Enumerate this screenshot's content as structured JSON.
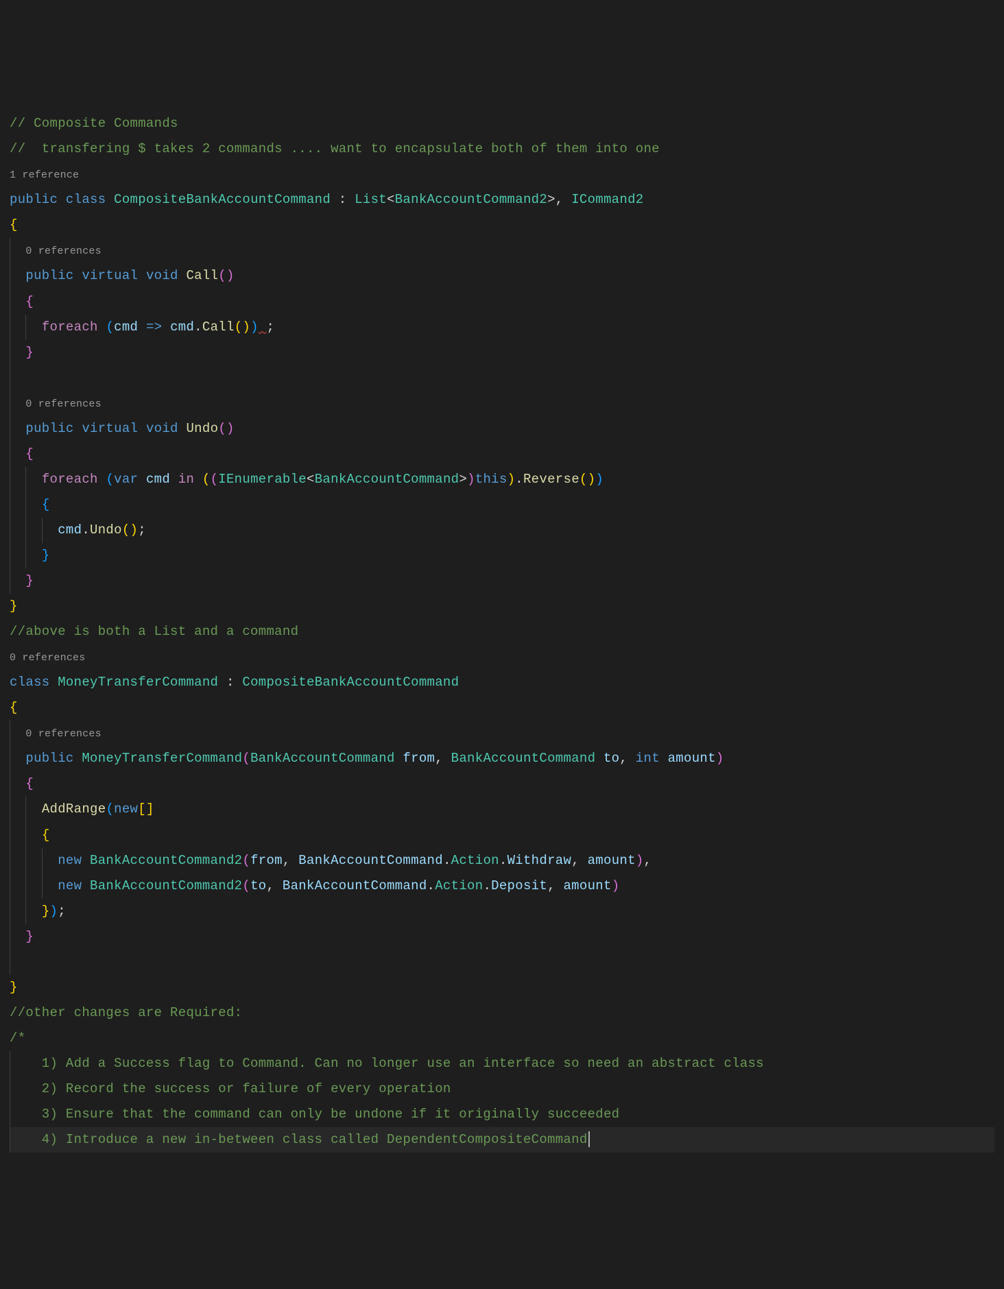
{
  "lines": {
    "l1_c": "// Composite Commands",
    "l2_c": "//  transfering $ takes 2 commands .... want to encapsulate both of them into one",
    "l3_ref": "1 reference",
    "l4": {
      "kw1": "public",
      "kw2": "class",
      "type1": "CompositeBankAccountCommand",
      "colon": ":",
      "type2": "List",
      "lt": "<",
      "type3": "BankAccountCommand2",
      "gt": ">",
      "comma": ",",
      "type4": "ICommand2"
    },
    "l5_b": "{",
    "l6_ref": "0 references",
    "l7": {
      "kw1": "public",
      "kw2": "virtual",
      "kw3": "void",
      "m": "Call"
    },
    "l8_b": "{",
    "l9": {
      "fe": "foreach",
      "v": "cmd",
      "arrow": "=>",
      "v2": "cmd",
      "m": "Call"
    },
    "l10_b": "}",
    "l11_ref": "0 references",
    "l12": {
      "kw1": "public",
      "kw2": "virtual",
      "kw3": "void",
      "m": "Undo"
    },
    "l13_b": "{",
    "l14": {
      "fe": "foreach",
      "var": "var",
      "v": "cmd",
      "in": "in",
      "t1": "IEnumerable",
      "t2": "BankAccountCommand",
      "th": "this",
      "m": "Reverse"
    },
    "l15_b": "{",
    "l16": {
      "v": "cmd",
      "m": "Undo"
    },
    "l17_b": "}",
    "l18_b": "}",
    "l19_b": "}",
    "l20_c": "//above is both a List and a command",
    "l21_ref": "0 references",
    "l22": {
      "kw": "class",
      "t1": "MoneyTransferCommand",
      "colon": ":",
      "t2": "CompositeBankAccountCommand"
    },
    "l23_b": "{",
    "l24_ref": "0 references",
    "l25": {
      "kw": "public",
      "t1": "MoneyTransferCommand",
      "t2": "BankAccountCommand",
      "p1": "from",
      "t3": "BankAccountCommand",
      "p2": "to",
      "t4": "int",
      "p3": "amount"
    },
    "l26_b": "{",
    "l27": {
      "m": "AddRange",
      "kw": "new"
    },
    "l28_b": "{",
    "l29": {
      "kw": "new",
      "t1": "BankAccountCommand2",
      "v1": "from",
      "t2": "BankAccountCommand",
      "e1": "Action",
      "e2": "Withdraw",
      "v2": "amount"
    },
    "l30": {
      "kw": "new",
      "t1": "BankAccountCommand2",
      "v1": "to",
      "t2": "BankAccountCommand",
      "e1": "Action",
      "e2": "Deposit",
      "v2": "amount"
    },
    "l31_b": "});",
    "l32_b": "}",
    "l33_b": "}",
    "l34_c": "//other changes are Required:",
    "l35_c": "/*",
    "l36_c": "  1) Add a Success flag to Command. Can no longer use an interface so need an abstract class",
    "l37_c": "  2) Record the success or failure of every operation",
    "l38_c": "  3) Ensure that the command can only be undone if it originally succeeded",
    "l39_c": "  4) Introduce a new in-between class called DependentCompositeCommand"
  }
}
